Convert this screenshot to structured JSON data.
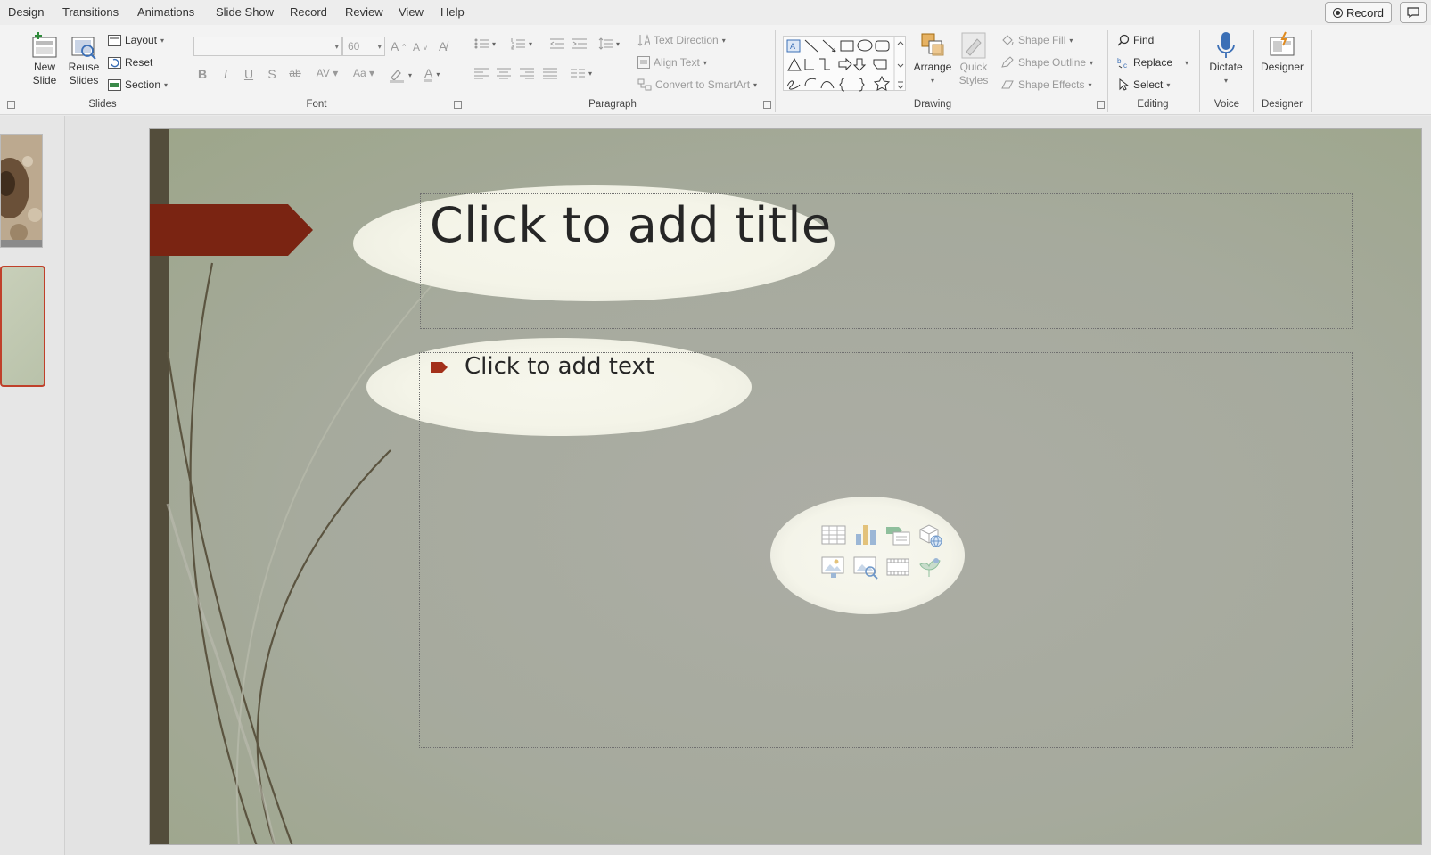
{
  "menu": {
    "tabs": [
      "Design",
      "Transitions",
      "Animations",
      "Slide Show",
      "Record",
      "Review",
      "View",
      "Help"
    ],
    "record_button": "Record"
  },
  "ribbon": {
    "slides": {
      "new_slide": "New Slide",
      "reuse_slides": "Reuse Slides",
      "layout": "Layout",
      "reset": "Reset",
      "section": "Section",
      "label": "Slides"
    },
    "font": {
      "font_name": "",
      "font_size": "60",
      "label": "Font"
    },
    "paragraph": {
      "text_direction": "Text Direction",
      "align_text": "Align Text",
      "convert_smartart": "Convert to SmartArt",
      "label": "Paragraph"
    },
    "drawing": {
      "arrange": "Arrange",
      "quick_styles": "Quick Styles",
      "shape_fill": "Shape Fill",
      "shape_outline": "Shape Outline",
      "shape_effects": "Shape Effects",
      "label": "Drawing"
    },
    "editing": {
      "find": "Find",
      "replace": "Replace",
      "select": "Select",
      "label": "Editing"
    },
    "voice": {
      "dictate": "Dictate",
      "label": "Voice"
    },
    "designer": {
      "designer": "Designer",
      "label": "Designer"
    }
  },
  "slide": {
    "title_placeholder": "Click to add title",
    "body_placeholder": "Click to add text",
    "insert_icons": [
      "table-icon",
      "chart-icon",
      "smartart-icon",
      "3d-model-icon",
      "picture-icon",
      "online-picture-icon",
      "video-icon",
      "icons-icon"
    ]
  },
  "colors": {
    "accent": "#8b2a17",
    "side_bar": "#534d3b",
    "selected_thumb": "#c0402a"
  }
}
